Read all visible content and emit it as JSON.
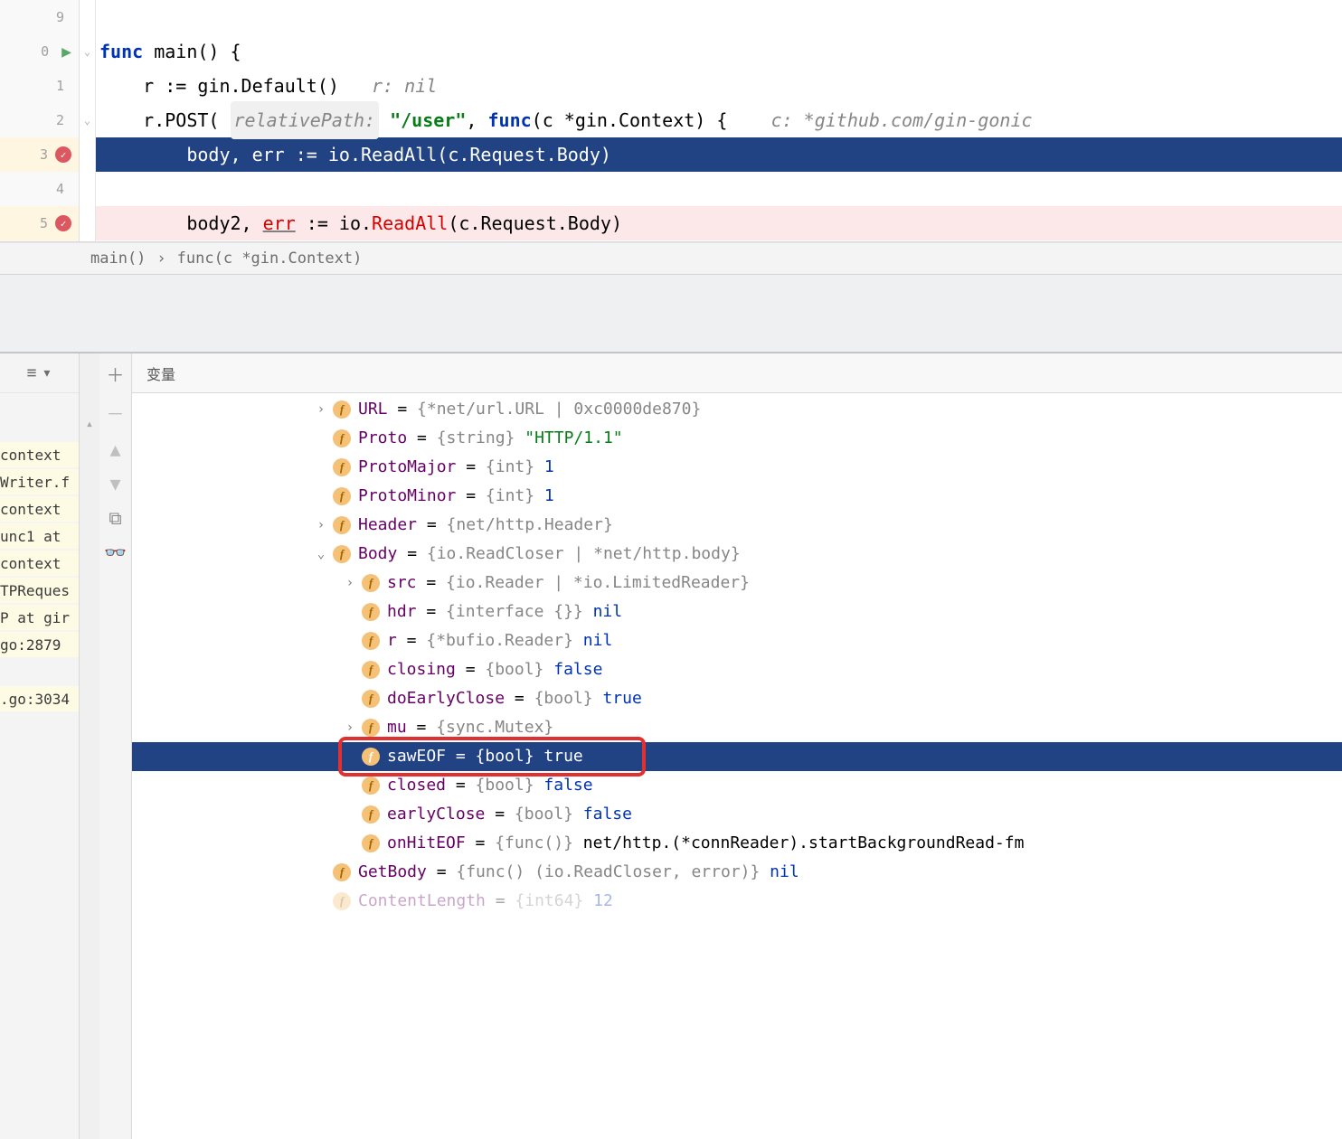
{
  "editor": {
    "lines": [
      {
        "n": "9",
        "parts": []
      },
      {
        "n": "0",
        "play": true,
        "fold": true,
        "parts": [
          {
            "t": "func",
            "c": "tok-kw"
          },
          {
            "t": " main() {"
          }
        ]
      },
      {
        "n": "1",
        "parts": [
          {
            "t": "    r := gin.Default()   "
          },
          {
            "t": "r: nil",
            "c": "tok-hint"
          }
        ]
      },
      {
        "n": "2",
        "fold": true,
        "parts": [
          {
            "t": "    r.POST( "
          },
          {
            "t": "relativePath:",
            "c": "tok-param"
          },
          {
            "t": " "
          },
          {
            "t": "\"/user\"",
            "c": "tok-str"
          },
          {
            "t": ", "
          },
          {
            "t": "func",
            "c": "tok-kw"
          },
          {
            "t": "(c *gin.Context) {    "
          },
          {
            "t": "c: *github.com/gin-gonic",
            "c": "tok-hint"
          }
        ]
      },
      {
        "n": "3",
        "bp": true,
        "selected": true,
        "parts": [
          {
            "t": "        body, err := io.ReadAll(c.Request.Body)"
          }
        ]
      },
      {
        "n": "4",
        "parts": []
      },
      {
        "n": "5",
        "bp": true,
        "error": true,
        "parts": [
          {
            "t": "        body2, "
          },
          {
            "t": "err",
            "c": "tok-err underline"
          },
          {
            "t": " := io."
          },
          {
            "t": "ReadAll",
            "c": "tok-err"
          },
          {
            "t": "(c.Request.Body)"
          }
        ]
      }
    ]
  },
  "breadcrumb": {
    "items": [
      "main()",
      "›",
      "func(c *gin.Context)"
    ]
  },
  "debugger": {
    "var_tab": "变量",
    "frames": [
      "context",
      "Writer.f",
      "context",
      "unc1 at",
      "context",
      "TPReques",
      "P at gir",
      "go:2879",
      "",
      ".go:3034"
    ],
    "vars": [
      {
        "indent": 1,
        "exp": ">",
        "name": "URL",
        "type": "{*net/url.URL | 0xc0000de870}",
        "val": null
      },
      {
        "indent": 1,
        "exp": "",
        "name": "Proto",
        "type": "{string}",
        "val": "\"HTTP/1.1\"",
        "str": true
      },
      {
        "indent": 1,
        "exp": "",
        "name": "ProtoMajor",
        "type": "{int}",
        "val": "1"
      },
      {
        "indent": 1,
        "exp": "",
        "name": "ProtoMinor",
        "type": "{int}",
        "val": "1"
      },
      {
        "indent": 1,
        "exp": ">",
        "name": "Header",
        "type": "{net/http.Header}",
        "val": null
      },
      {
        "indent": 1,
        "exp": "v",
        "name": "Body",
        "type": "{io.ReadCloser | *net/http.body}",
        "val": null
      },
      {
        "indent": 2,
        "exp": ">",
        "name": "src",
        "type": "{io.Reader | *io.LimitedReader}",
        "val": null
      },
      {
        "indent": 2,
        "exp": "",
        "name": "hdr",
        "type": "{interface {}}",
        "val": "nil"
      },
      {
        "indent": 2,
        "exp": "",
        "name": "r",
        "type": "{*bufio.Reader}",
        "val": "nil"
      },
      {
        "indent": 2,
        "exp": "",
        "name": "closing",
        "type": "{bool}",
        "val": "false"
      },
      {
        "indent": 2,
        "exp": "",
        "name": "doEarlyClose",
        "type": "{bool}",
        "val": "true"
      },
      {
        "indent": 2,
        "exp": ">",
        "name": "mu",
        "type": "{sync.Mutex}",
        "val": null
      },
      {
        "indent": 2,
        "exp": "",
        "name": "sawEOF",
        "type": "{bool}",
        "val": "true",
        "selected": true,
        "highlighted": true
      },
      {
        "indent": 2,
        "exp": "",
        "name": "closed",
        "type": "{bool}",
        "val": "false"
      },
      {
        "indent": 2,
        "exp": "",
        "name": "earlyClose",
        "type": "{bool}",
        "val": "false"
      },
      {
        "indent": 2,
        "exp": "",
        "name": "onHitEOF",
        "type": "{func()}",
        "val": "net/http.(*connReader).startBackgroundRead-fm",
        "func": true
      },
      {
        "indent": 1,
        "exp": "",
        "name": "GetBody",
        "type": "{func() (io.ReadCloser, error)}",
        "val": "nil"
      },
      {
        "indent": 1,
        "exp": "",
        "name": "ContentLength",
        "type": "{int64}",
        "val": "12",
        "cut": true
      }
    ]
  }
}
